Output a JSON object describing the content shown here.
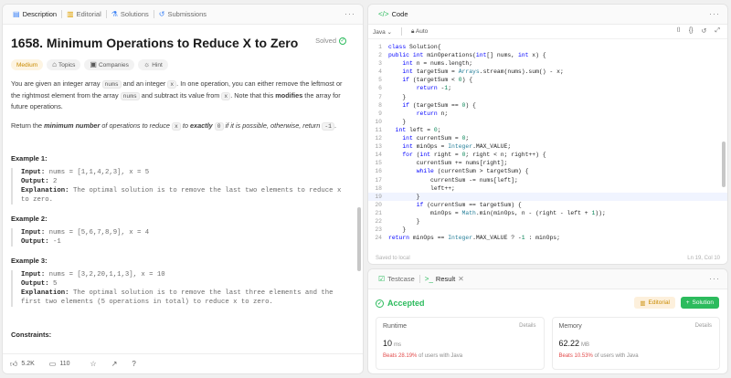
{
  "left_tabs": {
    "description": "Description",
    "editorial": "Editorial",
    "solutions": "Solutions",
    "submissions": "Submissions"
  },
  "problem": {
    "title": "1658. Minimum Operations to Reduce X to Zero",
    "solved": "Solved",
    "difficulty": "Medium",
    "tags": [
      "Topics",
      "Companies",
      "Hint"
    ],
    "p1_a": "You are given an integer array ",
    "p1_code1": "nums",
    "p1_b": " and an integer ",
    "p1_code2": "x",
    "p1_c": ". In one operation, you can either remove the leftmost or the rightmost element from the array ",
    "p1_code3": "nums",
    "p1_d": " and subtract its value from ",
    "p1_code4": "x",
    "p1_e": ". Note that this ",
    "p1_bold": "modifies",
    "p1_f": " the array for future operations.",
    "p2_a": "Return the ",
    "p2_bold1": "minimum number",
    "p2_b": " of operations to reduce ",
    "p2_code1": "x",
    "p2_c": " to ",
    "p2_bold2": "exactly",
    "p2_code2": "0",
    "p2_d": " if it is possible, otherwise, return ",
    "p2_code3": "-1",
    "p2_e": ".",
    "examples": [
      {
        "title": "Example 1:",
        "input": "nums = [1,1,4,2,3], x = 5",
        "output": "2",
        "explanation": "The optimal solution is to remove the last two elements to reduce x to zero."
      },
      {
        "title": "Example 2:",
        "input": "nums = [5,6,7,8,9], x = 4",
        "output": "-1",
        "explanation": ""
      },
      {
        "title": "Example 3:",
        "input": "nums = [3,2,20,1,1,3], x = 10",
        "output": "5",
        "explanation": "The optimal solution is to remove the last three elements and the first two elements (5 operations in total) to reduce x to zero."
      }
    ],
    "labels": {
      "input": "Input:",
      "output": "Output:",
      "explanation": "Explanation:"
    },
    "constraints": "Constraints:"
  },
  "footer": {
    "likes": "5.2K",
    "comments": "110"
  },
  "code_panel": {
    "title": "Code",
    "language": "Java",
    "auto": "Auto",
    "saved": "Saved to local",
    "cursor": "Ln 19, Col 10",
    "lines": [
      "class Solution{",
      "public int minOperations(int[] nums, int x) {",
      "    int n = nums.length;",
      "    int targetSum = Arrays.stream(nums).sum() - x;",
      "    if (targetSum < 0) {",
      "        return -1;",
      "    }",
      "    if (targetSum == 0) {",
      "        return n;",
      "    }",
      "  int left = 0;",
      "    int currentSum = 0;",
      "    int minOps = Integer.MAX_VALUE;",
      "    for (int right = 0; right < n; right++) {",
      "        currentSum += nums[right];",
      "        while (currentSum > targetSum) {",
      "            currentSum -= nums[left];",
      "            left++;",
      "        }",
      "        if (currentSum == targetSum) {",
      "            minOps = Math.min(minOps, n - (right - left + 1));",
      "        }",
      "    }",
      "return minOps == Integer.MAX_VALUE ? -1 : minOps;"
    ]
  },
  "result_panel": {
    "tab_testcase": "Testcase",
    "tab_result": "Result",
    "status": "Accepted",
    "editorial_btn": "Editorial",
    "solution_btn": "Solution",
    "runtime": {
      "label": "Runtime",
      "details": "Details",
      "value": "10",
      "unit": "ms",
      "beats": "Beats 28.19%",
      "suffix": "of users with Java"
    },
    "memory": {
      "label": "Memory",
      "details": "Details",
      "value": "62.22",
      "unit": "MB",
      "beats": "Beats 10.53%",
      "suffix": "of users with Java"
    }
  }
}
